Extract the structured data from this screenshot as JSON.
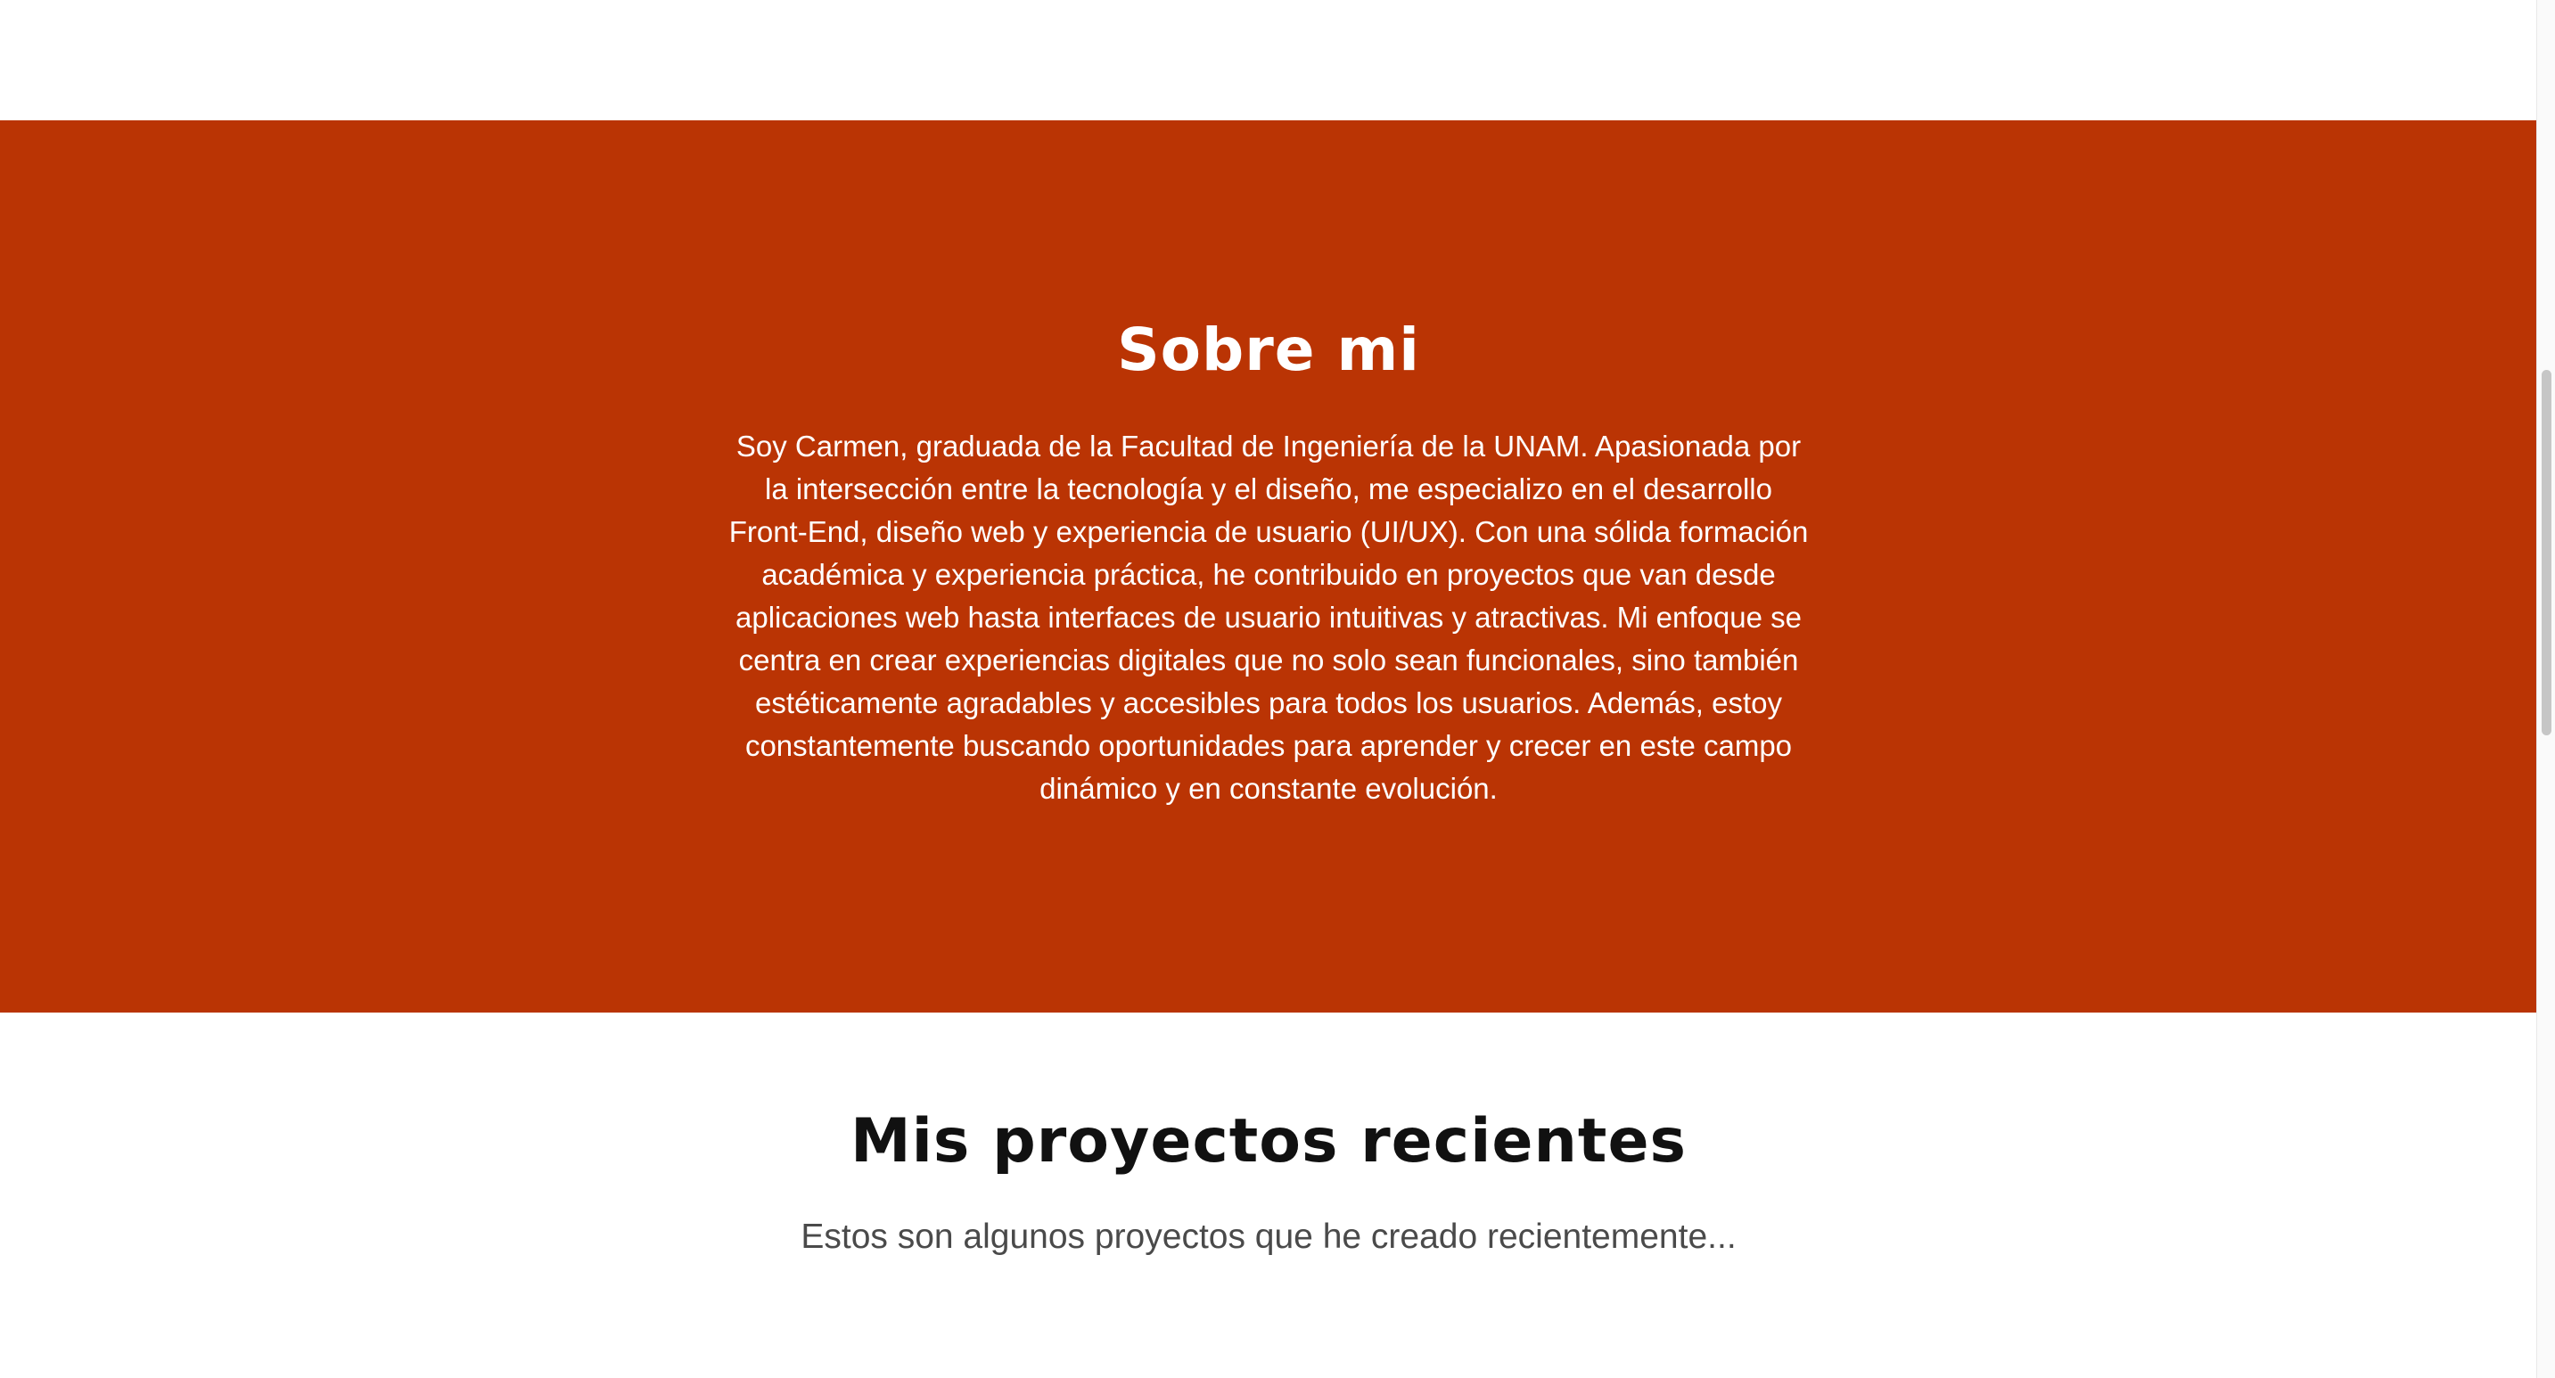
{
  "about": {
    "title": "Sobre mi",
    "text": "Soy Carmen, graduada de la Facultad de Ingeniería de la UNAM. Apasionada por la intersección entre la tecnología y el diseño, me especializo en el desarrollo Front-End, diseño web y experiencia de usuario (UI/UX). Con una sólida formación académica y experiencia práctica, he contribuido en proyectos que van desde aplicaciones web hasta interfaces de usuario intuitivas y atractivas. Mi enfoque se centra en crear experiencias digitales que no solo sean funcionales, sino también estéticamente agradables y accesibles para todos los usuarios. Además, estoy constantemente buscando oportunidades para aprender y crecer en este campo dinámico y en constante evolución."
  },
  "projects": {
    "title": "Mis proyectos recientes",
    "subtitle": "Estos son algunos proyectos que he creado recientemente..."
  },
  "colors": {
    "about_background": "#ba3404",
    "page_background": "#ffffff",
    "heading_dark": "#111111",
    "subtitle_gray": "#4a4a4a"
  }
}
